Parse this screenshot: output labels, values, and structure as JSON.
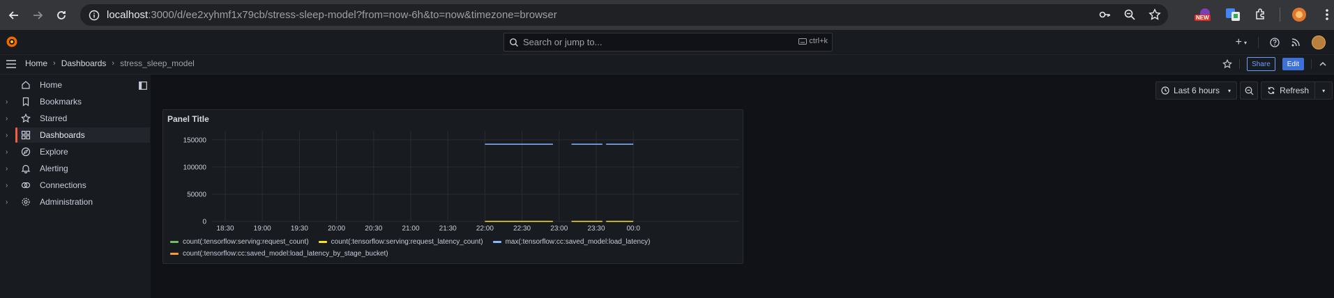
{
  "browser": {
    "url_host": "localhost",
    "url_rest": ":3000/d/ee2xyhmf1x79cb/stress-sleep-model?from=now-6h&to=now&timezone=browser",
    "new_badge": "NEW"
  },
  "topbar": {
    "search_placeholder": "Search or jump to...",
    "search_shortcut": "ctrl+k",
    "new_button": "+"
  },
  "breadcrumb": {
    "items": [
      "Home",
      "Dashboards",
      "stress_sleep_model"
    ]
  },
  "actions": {
    "share_label": "Share",
    "edit_label": "Edit"
  },
  "sidebar": {
    "items": [
      {
        "label": "Home",
        "icon": "home-icon"
      },
      {
        "label": "Bookmarks",
        "icon": "bookmark-icon"
      },
      {
        "label": "Starred",
        "icon": "star-icon"
      },
      {
        "label": "Dashboards",
        "icon": "dashboards-grid-icon",
        "active": true
      },
      {
        "label": "Explore",
        "icon": "compass-icon"
      },
      {
        "label": "Alerting",
        "icon": "bell-icon"
      },
      {
        "label": "Connections",
        "icon": "connections-icon"
      },
      {
        "label": "Administration",
        "icon": "gear-icon"
      }
    ]
  },
  "toolbar": {
    "time_range": "Last 6 hours",
    "refresh_label": "Refresh"
  },
  "panel": {
    "title": "Panel Title"
  },
  "chart_data": {
    "type": "line",
    "title": "Panel Title",
    "x_ticks": [
      "18:30",
      "19:00",
      "19:30",
      "20:00",
      "20:30",
      "21:00",
      "21:30",
      "22:00",
      "22:30",
      "23:00",
      "23:30",
      "00:0"
    ],
    "y_ticks": [
      0,
      50000,
      100000,
      150000
    ],
    "y_tick_labels": [
      "0",
      "50000",
      "100000",
      "150000"
    ],
    "ylim": [
      0,
      160000
    ],
    "grid": true,
    "legend_position": "bottom",
    "series": [
      {
        "name": "count(:tensorflow:serving:request_count)",
        "color": "#73bf69",
        "segments": []
      },
      {
        "name": "count(:tensorflow:serving:request_latency_count)",
        "color": "#fade2a",
        "segments": [
          {
            "from": "22:00",
            "to": "22:55",
            "value": 0
          },
          {
            "from": "23:10",
            "to": "23:35",
            "value": 0
          },
          {
            "from": "23:38",
            "to": "00:00",
            "value": 0
          }
        ]
      },
      {
        "name": "max(:tensorflow:cc:saved_model:load_latency)",
        "color": "#8ab8ff",
        "segments": [
          {
            "from": "22:00",
            "to": "22:55",
            "value": 142000
          },
          {
            "from": "23:10",
            "to": "23:35",
            "value": 142000
          },
          {
            "from": "23:38",
            "to": "00:00",
            "value": 142000
          }
        ]
      },
      {
        "name": "count(:tensorflow:cc:saved_model:load_latency_by_stage_bucket)",
        "color": "#ff9830",
        "segments": []
      }
    ]
  }
}
